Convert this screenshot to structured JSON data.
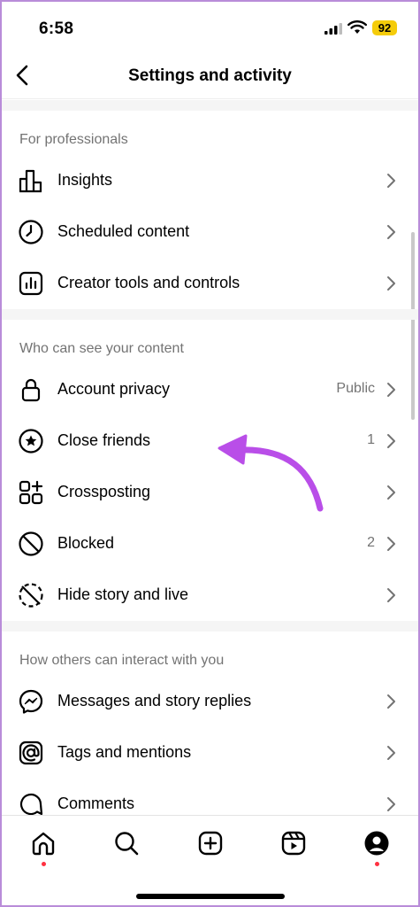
{
  "status_bar": {
    "time": "6:58",
    "battery": "92"
  },
  "header": {
    "title": "Settings and activity"
  },
  "sections": [
    {
      "title": "For professionals",
      "items": [
        {
          "label": "Insights",
          "value": "",
          "icon": "bar-chart-icon"
        },
        {
          "label": "Scheduled content",
          "value": "",
          "icon": "clock-icon"
        },
        {
          "label": "Creator tools and controls",
          "value": "",
          "icon": "chart-square-icon"
        }
      ]
    },
    {
      "title": "Who can see your content",
      "items": [
        {
          "label": "Account privacy",
          "value": "Public",
          "icon": "lock-icon"
        },
        {
          "label": "Close friends",
          "value": "1",
          "icon": "star-circle-icon"
        },
        {
          "label": "Crossposting",
          "value": "",
          "icon": "grid-plus-icon"
        },
        {
          "label": "Blocked",
          "value": "2",
          "icon": "blocked-icon"
        },
        {
          "label": "Hide story and live",
          "value": "",
          "icon": "hide-story-icon"
        }
      ]
    },
    {
      "title": "How others can interact with you",
      "items": [
        {
          "label": "Messages and story replies",
          "value": "",
          "icon": "messenger-icon"
        },
        {
          "label": "Tags and mentions",
          "value": "",
          "icon": "at-sign-icon"
        },
        {
          "label": "Comments",
          "value": "",
          "icon": "comment-icon"
        }
      ]
    }
  ],
  "tab_bar": {
    "items": [
      "home-icon",
      "search-icon",
      "create-icon",
      "reels-icon",
      "profile-icon"
    ],
    "notification_color": "#ff3040"
  },
  "annotation": {
    "arrow_color": "#b94ee8"
  }
}
